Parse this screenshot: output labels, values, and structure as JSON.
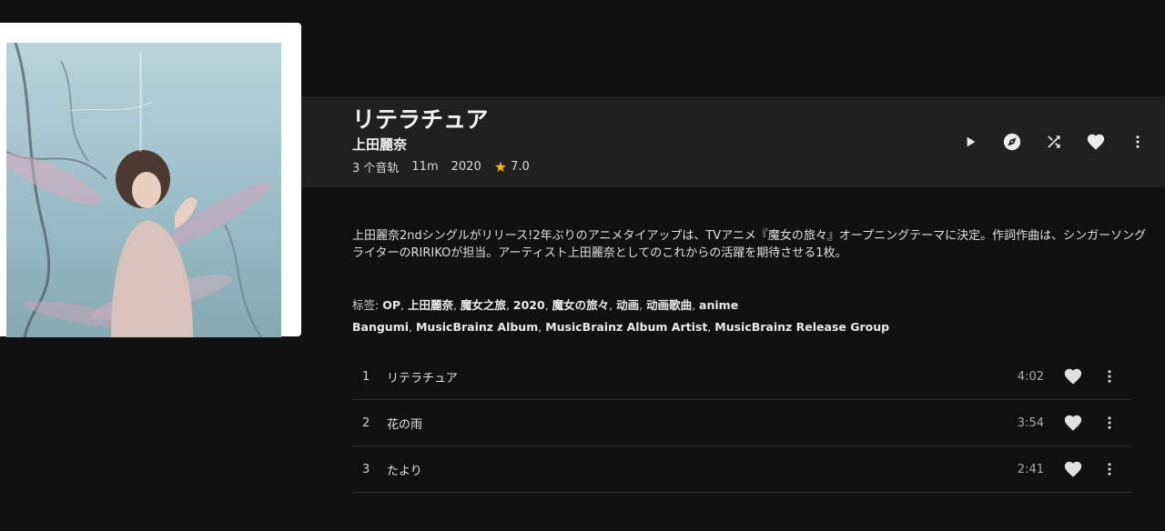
{
  "album": {
    "title": "リテラチュア",
    "artist": "上田麗奈",
    "track_count": "3 个音轨",
    "duration": "11m",
    "year": "2020",
    "rating": "7.0"
  },
  "actions": {
    "icons": [
      "play-icon",
      "explore-icon",
      "shuffle-icon",
      "heart-icon",
      "more-vert-icon"
    ]
  },
  "description": "上田麗奈2ndシングルがリリース!2年ぶりのアニメタイアップは、TVアニメ『魔女の旅々』オープニングテーマに決定。作詞作曲は、シンガーソングライターのRIRIKOが担当。アーティスト上田麗奈としてのこれからの活躍を期待させる1枚。",
  "tags": {
    "label": "标签:",
    "line1": [
      "OP",
      "上田麗奈",
      "魔女之旅",
      "2020",
      "魔女の旅々",
      "动画",
      "动画歌曲",
      "anime"
    ],
    "line2": [
      "Bangumi",
      "MusicBrainz Album",
      "MusicBrainz Album Artist",
      "MusicBrainz Release Group"
    ]
  },
  "tracks": [
    {
      "num": "1",
      "title": "リテラチュア",
      "duration": "4:02"
    },
    {
      "num": "2",
      "title": "花の雨",
      "duration": "3:54"
    },
    {
      "num": "3",
      "title": "たより",
      "duration": "2:41"
    }
  ],
  "colors": {
    "background": "#111111",
    "header_band": "#202020",
    "star": "#f5b400"
  }
}
